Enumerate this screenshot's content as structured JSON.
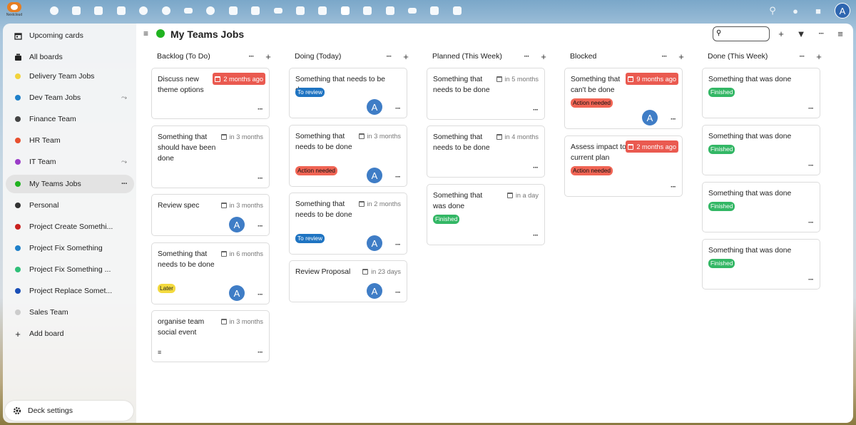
{
  "app": {
    "logo_text": "Nextcloud",
    "avatar_letter": "A",
    "top_icons": [
      "dashboard-icon",
      "files-icon",
      "photos-icon",
      "activity-icon",
      "talk-icon",
      "search-chat-icon",
      "mail-icon",
      "contacts-clock-icon",
      "contacts-icon",
      "calendar-icon",
      "analytics-icon",
      "favorites-icon",
      "notes-icon",
      "deck-icon",
      "tasks-icon",
      "checkmark-icon",
      "tables-icon",
      "text-icon",
      "maps-icon"
    ]
  },
  "sidebar": {
    "upcoming": "Upcoming cards",
    "all_boards": "All boards",
    "boards": [
      {
        "label": "Delivery Team Jobs",
        "color": "#f2d33b",
        "shared": false
      },
      {
        "label": "Dev Team Jobs",
        "color": "#1f80c9",
        "shared": true
      },
      {
        "label": "Finance Team",
        "color": "#444444",
        "shared": false
      },
      {
        "label": "HR Team",
        "color": "#e8502f",
        "shared": false
      },
      {
        "label": "IT Team",
        "color": "#9b3dc8",
        "shared": true
      },
      {
        "label": "My Teams Jobs",
        "color": "#20b320",
        "shared": false
      },
      {
        "label": "Personal",
        "color": "#333333",
        "shared": false
      },
      {
        "label": "Project Create Somethi...",
        "color": "#c9211e",
        "shared": false
      },
      {
        "label": "Project Fix Something",
        "color": "#1f80c9",
        "shared": false
      },
      {
        "label": "Project Fix Something ...",
        "color": "#2fbf78",
        "shared": false
      },
      {
        "label": "Project Replace Somet...",
        "color": "#1a4fb7",
        "shared": false
      },
      {
        "label": "Sales Team",
        "color": "#cccccc",
        "shared": false
      }
    ],
    "add_board": "Add board",
    "deck_settings": "Deck settings"
  },
  "board": {
    "title": "My Teams Jobs",
    "color": "#20b320"
  },
  "stacks": [
    {
      "title": "Backlog (To Do)",
      "cards": [
        {
          "title": "Discuss new theme options",
          "due": "2 months ago",
          "overdue": true,
          "label": null,
          "avatar": false,
          "desc": false
        },
        {
          "title": "Something that should have been done",
          "due": "in 3 months",
          "overdue": false,
          "label": null,
          "avatar": false,
          "desc": false
        },
        {
          "title": "Review spec",
          "due": "in 3 months",
          "overdue": false,
          "label": null,
          "avatar": true,
          "desc": false
        },
        {
          "title": "Something that needs to be done",
          "due": "in 6 months",
          "overdue": false,
          "label": {
            "text": "Later",
            "kind": "later"
          },
          "avatar": true,
          "desc": false
        },
        {
          "title": "organise team social event",
          "due": "in 3 months",
          "overdue": false,
          "label": null,
          "avatar": false,
          "desc": true
        }
      ]
    },
    {
      "title": "Doing (Today)",
      "cards": [
        {
          "title": "Something that needs to be done",
          "due": null,
          "overdue": false,
          "label": {
            "text": "To review",
            "kind": "review"
          },
          "avatar": true,
          "desc": false
        },
        {
          "title": "Something that needs to be done",
          "due": "in 3 months",
          "overdue": false,
          "label": {
            "text": "Action needed",
            "kind": "action"
          },
          "avatar": true,
          "desc": false
        },
        {
          "title": "Something that needs to be done",
          "due": "in 2 months",
          "overdue": false,
          "label": {
            "text": "To review",
            "kind": "review"
          },
          "avatar": true,
          "desc": false
        },
        {
          "title": "Review Proposal",
          "due": "in 23 days",
          "overdue": false,
          "label": null,
          "avatar": true,
          "desc": false
        }
      ]
    },
    {
      "title": "Planned (This Week)",
      "cards": [
        {
          "title": "Something that needs to be done",
          "due": "in 5 months",
          "overdue": false,
          "label": null,
          "avatar": false,
          "desc": false
        },
        {
          "title": "Something that needs to be done",
          "due": "in 4 months",
          "overdue": false,
          "label": null,
          "avatar": false,
          "desc": false
        },
        {
          "title": "Something that was done",
          "due": "in a day",
          "overdue": false,
          "label": {
            "text": "Finished",
            "kind": "finished"
          },
          "avatar": false,
          "desc": false
        }
      ]
    },
    {
      "title": "Blocked",
      "cards": [
        {
          "title": "Something that can't be done",
          "due": "9 months ago",
          "overdue": true,
          "label": {
            "text": "Action needed",
            "kind": "action"
          },
          "avatar": true,
          "desc": false
        },
        {
          "title": "Assess impact to current plan",
          "due": "2 months ago",
          "overdue": true,
          "label": {
            "text": "Action needed",
            "kind": "action"
          },
          "avatar": false,
          "desc": false
        }
      ]
    },
    {
      "title": "Done (This Week)",
      "cards": [
        {
          "title": "Something that was done",
          "due": null,
          "overdue": false,
          "label": {
            "text": "Finished",
            "kind": "finished"
          },
          "avatar": false,
          "desc": false
        },
        {
          "title": "Something that was done",
          "due": null,
          "overdue": false,
          "label": {
            "text": "Finished",
            "kind": "finished"
          },
          "avatar": false,
          "desc": false
        },
        {
          "title": "Something that was done",
          "due": null,
          "overdue": false,
          "label": {
            "text": "Finished",
            "kind": "finished"
          },
          "avatar": false,
          "desc": false
        },
        {
          "title": "Something that was done",
          "due": null,
          "overdue": false,
          "label": {
            "text": "Finished",
            "kind": "finished"
          },
          "avatar": false,
          "desc": false
        }
      ]
    }
  ]
}
